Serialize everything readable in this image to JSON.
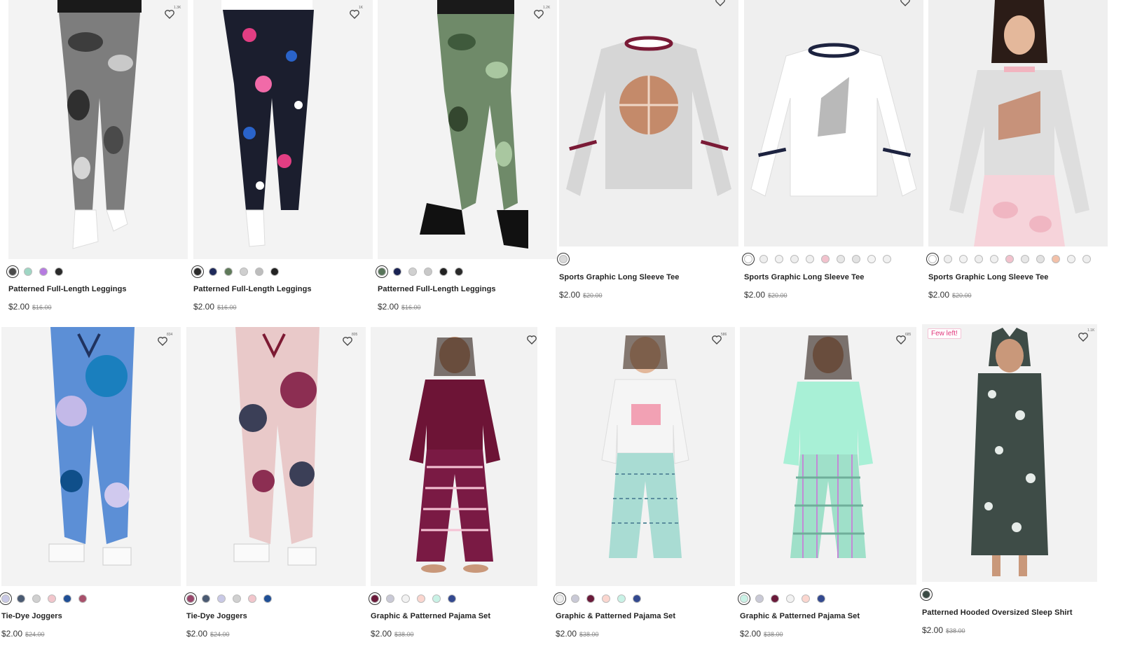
{
  "colors": {
    "accent": "#e0357a",
    "text": "#222222",
    "muted": "#888888"
  },
  "products_row1": [
    {
      "name": "Patterned Full-Length Leggings",
      "price": "$2.00",
      "original_price": "$16.00",
      "fav_count": "1.3K",
      "swatches": [
        "#4a4a4a",
        "#9fd6c4",
        "#b67be0",
        "#2a2a2a"
      ]
    },
    {
      "name": "Patterned Full-Length Leggings",
      "price": "$2.00",
      "original_price": "$16.00",
      "fav_count": "1K",
      "swatches": [
        "#2b2b2b",
        "#1f2a5a",
        "#5f7a5a",
        "#cfcfcf",
        "#bdbdbd",
        "#222222"
      ]
    },
    {
      "name": "Patterned Full-Length Leggings",
      "price": "$2.00",
      "original_price": "$16.00",
      "fav_count": "1.2K",
      "swatches": [
        "#58745a",
        "#1a2353",
        "#d0d0d0",
        "#c8c8c8",
        "#222222",
        "#2a2a2a"
      ]
    },
    {
      "name": "Sports Graphic Long Sleeve Tee",
      "price": "$2.00",
      "original_price": "$20.00",
      "fav_count": "",
      "swatches": [
        "#d9d9d9"
      ]
    },
    {
      "name": "Sports Graphic Long Sleeve Tee",
      "price": "$2.00",
      "original_price": "$20.00",
      "fav_count": "",
      "swatches": [
        "#ffffff",
        "#eeeeee",
        "#f2f2f2",
        "#eeeeee",
        "#f0f0f0",
        "#f2c2cd",
        "#e7e7e7",
        "#e2e2e2",
        "#f4f4f4",
        "#f1f1f1"
      ]
    },
    {
      "name": "Sports Graphic Long Sleeve Tee",
      "price": "$2.00",
      "original_price": "$20.00",
      "fav_count": "",
      "swatches": [
        "#ffffff",
        "#eeeeee",
        "#f2f2f2",
        "#eeeeee",
        "#f0f0f0",
        "#f2c2cd",
        "#e7e7e7",
        "#e2e2e2",
        "#f3c1a9",
        "#f1f1f1",
        "#eeeeee"
      ]
    }
  ],
  "products_row2": [
    {
      "name": "Tie-Dye Joggers",
      "price": "$2.00",
      "original_price": "$24.00",
      "fav_count": "834",
      "badge": "",
      "swatches": [
        "#c9c9e6",
        "#4a5a72",
        "#d0d0d0",
        "#f2c6cc",
        "#1f4f96",
        "#a8506b"
      ]
    },
    {
      "name": "Tie-Dye Joggers",
      "price": "$2.00",
      "original_price": "$24.00",
      "fav_count": "805",
      "badge": "",
      "swatches": [
        "#99486c",
        "#4a5a72",
        "#c9c9e6",
        "#d0d0d0",
        "#f2c6cc",
        "#1f4f96"
      ]
    },
    {
      "name": "Graphic & Patterned Pajama Set",
      "price": "$2.00",
      "original_price": "$38.00",
      "fav_count": "",
      "badge": "",
      "swatches": [
        "#6a1a3a",
        "#c9c9d6",
        "#f2f2f2",
        "#fbd6cf",
        "#c9f2e6",
        "#33498f"
      ]
    },
    {
      "name": "Graphic & Patterned Pajama Set",
      "price": "$2.00",
      "original_price": "$38.00",
      "fav_count": "586",
      "badge": "",
      "swatches": [
        "#eeeeee",
        "#c9c9d6",
        "#6a1a3a",
        "#fbd6cf",
        "#c9f2e6",
        "#33498f"
      ]
    },
    {
      "name": "Graphic & Patterned Pajama Set",
      "price": "$2.00",
      "original_price": "$38.00",
      "fav_count": "685",
      "badge": "",
      "swatches": [
        "#c9f2e6",
        "#c9c9d6",
        "#6a1a3a",
        "#f2f2f2",
        "#fbd6cf",
        "#33498f"
      ]
    },
    {
      "name": "Patterned Hooded Oversized Sleep Shirt",
      "price": "$2.00",
      "original_price": "$38.00",
      "fav_count": "1.1K",
      "badge": "Few left!",
      "swatches": [
        "#3a4a44"
      ]
    }
  ]
}
